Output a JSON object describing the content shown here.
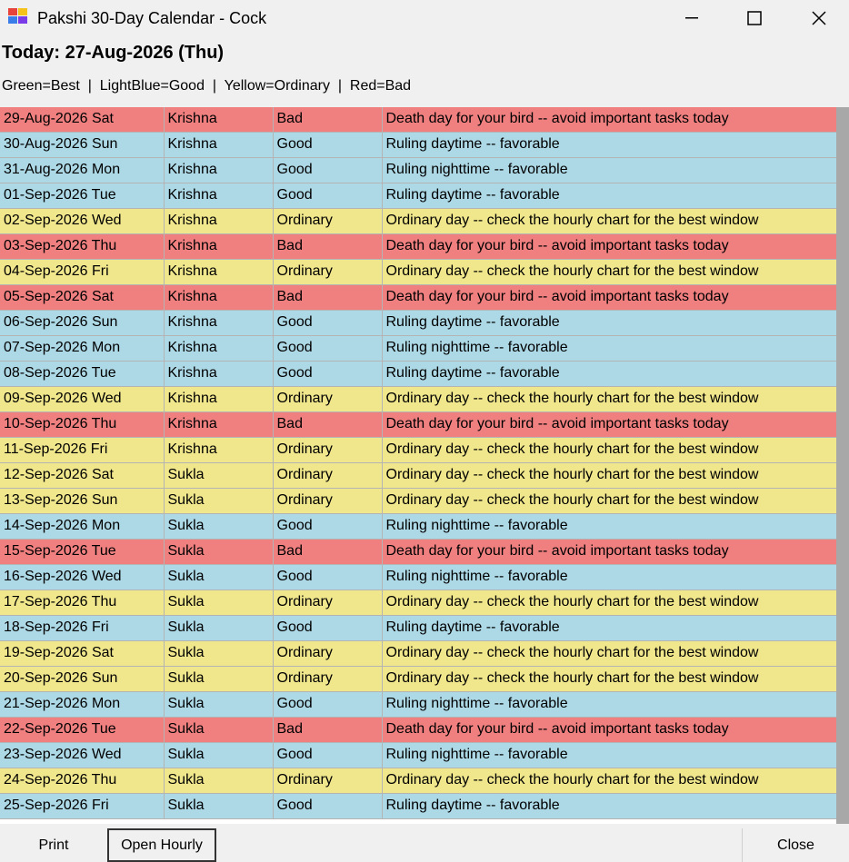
{
  "window": {
    "title": "Pakshi 30-Day Calendar - Cock",
    "minimize_icon": "minimize-icon",
    "maximize_icon": "maximize-icon",
    "close_icon": "close-icon"
  },
  "header": {
    "today": "Today: 27-Aug-2026 (Thu)",
    "legend": "Green=Best  |  LightBlue=Good  |  Yellow=Ordinary  |  Red=Bad"
  },
  "colors": {
    "Bad": "#f08080",
    "Good": "#add8e6",
    "Ordinary": "#f0e68c",
    "Best": "#90ee90"
  },
  "rows": [
    {
      "date": "29-Aug-2026 Sat",
      "paksha": "Krishna",
      "rating": "Bad",
      "note": "Death day for your bird -- avoid important tasks today"
    },
    {
      "date": "30-Aug-2026 Sun",
      "paksha": "Krishna",
      "rating": "Good",
      "note": "Ruling daytime -- favorable"
    },
    {
      "date": "31-Aug-2026 Mon",
      "paksha": "Krishna",
      "rating": "Good",
      "note": "Ruling nighttime -- favorable"
    },
    {
      "date": "01-Sep-2026 Tue",
      "paksha": "Krishna",
      "rating": "Good",
      "note": "Ruling daytime -- favorable"
    },
    {
      "date": "02-Sep-2026 Wed",
      "paksha": "Krishna",
      "rating": "Ordinary",
      "note": "Ordinary day -- check the hourly chart for the best window"
    },
    {
      "date": "03-Sep-2026 Thu",
      "paksha": "Krishna",
      "rating": "Bad",
      "note": "Death day for your bird -- avoid important tasks today"
    },
    {
      "date": "04-Sep-2026 Fri",
      "paksha": "Krishna",
      "rating": "Ordinary",
      "note": "Ordinary day -- check the hourly chart for the best window"
    },
    {
      "date": "05-Sep-2026 Sat",
      "paksha": "Krishna",
      "rating": "Bad",
      "note": "Death day for your bird -- avoid important tasks today"
    },
    {
      "date": "06-Sep-2026 Sun",
      "paksha": "Krishna",
      "rating": "Good",
      "note": "Ruling daytime -- favorable"
    },
    {
      "date": "07-Sep-2026 Mon",
      "paksha": "Krishna",
      "rating": "Good",
      "note": "Ruling nighttime -- favorable"
    },
    {
      "date": "08-Sep-2026 Tue",
      "paksha": "Krishna",
      "rating": "Good",
      "note": "Ruling daytime -- favorable"
    },
    {
      "date": "09-Sep-2026 Wed",
      "paksha": "Krishna",
      "rating": "Ordinary",
      "note": "Ordinary day -- check the hourly chart for the best window"
    },
    {
      "date": "10-Sep-2026 Thu",
      "paksha": "Krishna",
      "rating": "Bad",
      "note": "Death day for your bird -- avoid important tasks today"
    },
    {
      "date": "11-Sep-2026 Fri",
      "paksha": "Krishna",
      "rating": "Ordinary",
      "note": "Ordinary day -- check the hourly chart for the best window"
    },
    {
      "date": "12-Sep-2026 Sat",
      "paksha": "Sukla",
      "rating": "Ordinary",
      "note": "Ordinary day -- check the hourly chart for the best window"
    },
    {
      "date": "13-Sep-2026 Sun",
      "paksha": "Sukla",
      "rating": "Ordinary",
      "note": "Ordinary day -- check the hourly chart for the best window"
    },
    {
      "date": "14-Sep-2026 Mon",
      "paksha": "Sukla",
      "rating": "Good",
      "note": "Ruling nighttime -- favorable"
    },
    {
      "date": "15-Sep-2026 Tue",
      "paksha": "Sukla",
      "rating": "Bad",
      "note": "Death day for your bird -- avoid important tasks today"
    },
    {
      "date": "16-Sep-2026 Wed",
      "paksha": "Sukla",
      "rating": "Good",
      "note": "Ruling nighttime -- favorable"
    },
    {
      "date": "17-Sep-2026 Thu",
      "paksha": "Sukla",
      "rating": "Ordinary",
      "note": "Ordinary day -- check the hourly chart for the best window"
    },
    {
      "date": "18-Sep-2026 Fri",
      "paksha": "Sukla",
      "rating": "Good",
      "note": "Ruling daytime -- favorable"
    },
    {
      "date": "19-Sep-2026 Sat",
      "paksha": "Sukla",
      "rating": "Ordinary",
      "note": "Ordinary day -- check the hourly chart for the best window"
    },
    {
      "date": "20-Sep-2026 Sun",
      "paksha": "Sukla",
      "rating": "Ordinary",
      "note": "Ordinary day -- check the hourly chart for the best window"
    },
    {
      "date": "21-Sep-2026 Mon",
      "paksha": "Sukla",
      "rating": "Good",
      "note": "Ruling nighttime -- favorable"
    },
    {
      "date": "22-Sep-2026 Tue",
      "paksha": "Sukla",
      "rating": "Bad",
      "note": "Death day for your bird -- avoid important tasks today"
    },
    {
      "date": "23-Sep-2026 Wed",
      "paksha": "Sukla",
      "rating": "Good",
      "note": "Ruling nighttime -- favorable"
    },
    {
      "date": "24-Sep-2026 Thu",
      "paksha": "Sukla",
      "rating": "Ordinary",
      "note": "Ordinary day -- check the hourly chart for the best window"
    },
    {
      "date": "25-Sep-2026 Fri",
      "paksha": "Sukla",
      "rating": "Good",
      "note": "Ruling daytime -- favorable"
    }
  ],
  "buttons": {
    "print": "Print",
    "open_hourly": "Open Hourly",
    "close": "Close"
  }
}
